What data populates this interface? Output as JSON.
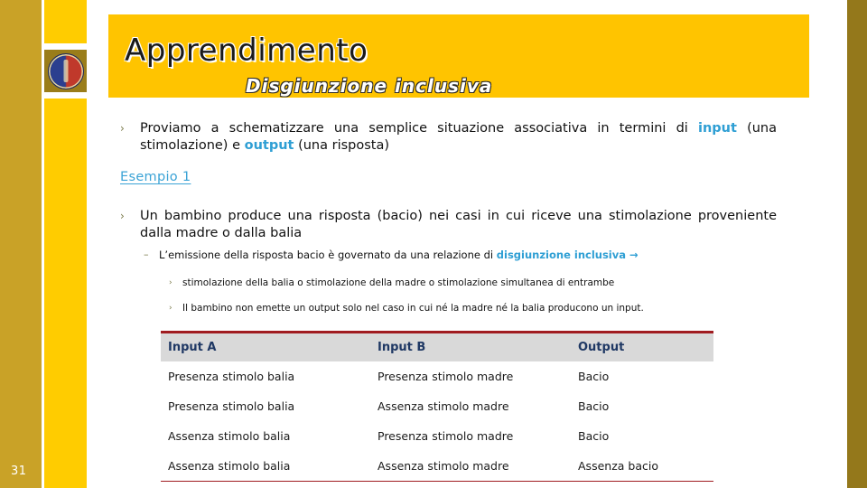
{
  "slide": {
    "number": "31",
    "title": "Apprendimento",
    "subtitle": "Disgiunzione  inclusiva"
  },
  "logo": {
    "name": "university-crest-logo"
  },
  "colors": {
    "band": "#ffc400",
    "left_strip": "#c9a227",
    "right_strip": "#94781b",
    "accent_blue": "#2f9fd4",
    "table_rule_red": "#a01c20",
    "table_header_bg": "#d9d9d9",
    "table_header_text": "#1f3864"
  },
  "body": {
    "bullet1": {
      "marker": "›",
      "part1": "Proviamo a schematizzare una semplice situazione associativa in termini di ",
      "accent1": "input",
      "part2": " (una stimolazione) e ",
      "accent2": "output",
      "part3": " (una risposta)"
    },
    "link": "Esempio  1",
    "bullet2": {
      "marker": "›",
      "text": "Un bambino produce una risposta (bacio) nei casi in cui riceve una stimolazione proveniente dalla madre o dalla balia"
    },
    "sub1": {
      "marker": "–",
      "part1": "L’emissione della risposta bacio è governato da una relazione di ",
      "accent": "disgiunzione inclusiva →"
    },
    "sub2": {
      "marker": "›",
      "text": "stimolazione della balia o stimolazione della madre o stimolazione simultanea di entrambe"
    },
    "sub3": {
      "marker": "›",
      "text": "Il bambino non emette un output solo nel caso in cui né la madre né la balia  producono un input."
    }
  },
  "table": {
    "headers": [
      "Input A",
      "Input B",
      "Output"
    ],
    "rows": [
      [
        "Presenza stimolo balia",
        "Presenza stimolo madre",
        "Bacio"
      ],
      [
        "Presenza stimolo balia",
        "Assenza stimolo madre",
        "Bacio"
      ],
      [
        "Assenza stimolo balia",
        "Presenza stimolo madre",
        "Bacio"
      ],
      [
        "Assenza stimolo balia",
        "Assenza stimolo madre",
        "Assenza bacio"
      ]
    ]
  }
}
